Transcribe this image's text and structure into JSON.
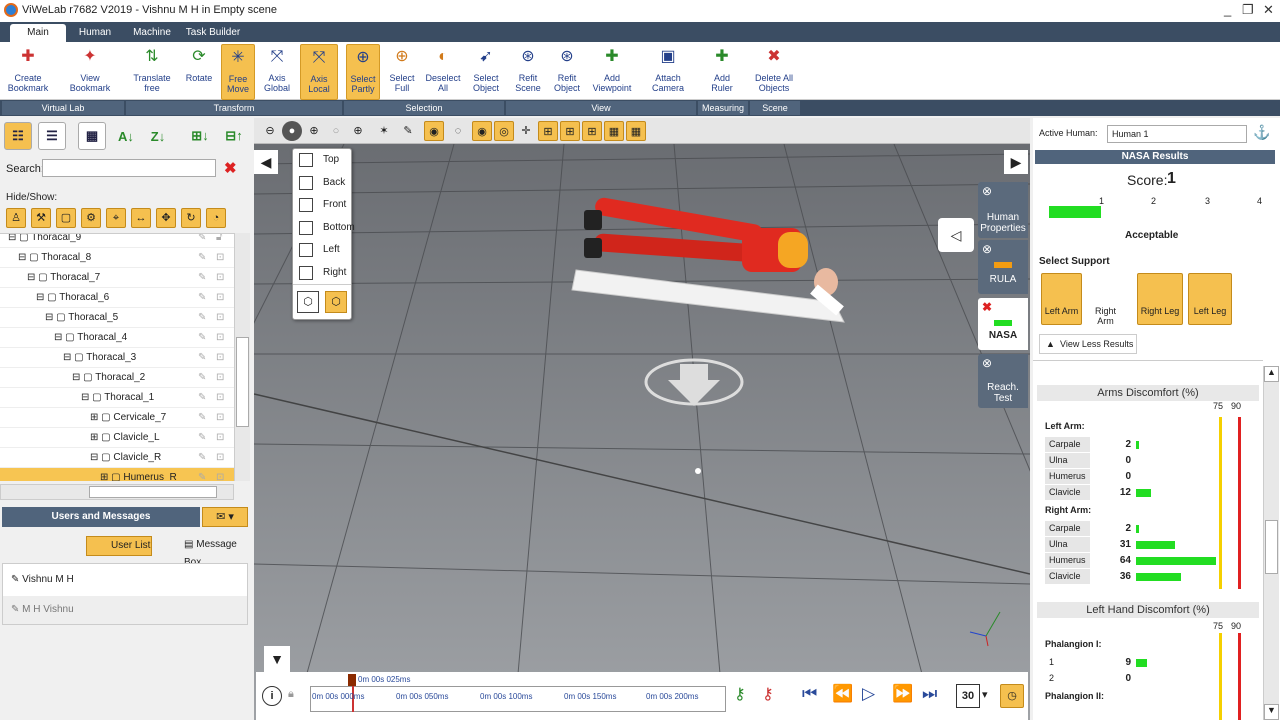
{
  "window": {
    "title": "ViWeLab r7682 V2019 - Vishnu  M H in Empty scene"
  },
  "ribbon": {
    "tabs": [
      "Main",
      "Human",
      "Machine",
      "Task Builder"
    ],
    "buttons": [
      {
        "l1": "Create",
        "l2": "Bookmark"
      },
      {
        "l1": "View",
        "l2": "Bookmark"
      },
      {
        "l1": "Translate",
        "l2": "free"
      },
      {
        "l1": "Rotate",
        "l2": ""
      },
      {
        "l1": "Free",
        "l2": "Move"
      },
      {
        "l1": "Axis",
        "l2": "Global"
      },
      {
        "l1": "Axis",
        "l2": "Local"
      },
      {
        "l1": "Select",
        "l2": "Partly"
      },
      {
        "l1": "Select",
        "l2": "Full"
      },
      {
        "l1": "Deselect",
        "l2": "All"
      },
      {
        "l1": "Select",
        "l2": "Object"
      },
      {
        "l1": "Refit",
        "l2": "Scene"
      },
      {
        "l1": "Refit",
        "l2": "Object"
      },
      {
        "l1": "Add",
        "l2": "Viewpoint"
      },
      {
        "l1": "Attach",
        "l2": "Camera"
      },
      {
        "l1": "Add",
        "l2": "Ruler"
      },
      {
        "l1": "Delete All",
        "l2": "Objects"
      }
    ],
    "groups": [
      "Virtual Lab",
      "Transform",
      "Selection",
      "View",
      "Measuring",
      "Scene"
    ]
  },
  "left": {
    "search_label": "Search:",
    "hideshow_label": "Hide/Show:",
    "tree": [
      "Thoracal_9",
      "Thoracal_8",
      "Thoracal_7",
      "Thoracal_6",
      "Thoracal_5",
      "Thoracal_4",
      "Thoracal_3",
      "Thoracal_2",
      "Thoracal_1",
      "Cervicale_7",
      "Clavicle_L",
      "Clavicle_R",
      "Humerus_R"
    ],
    "users_title": "Users and Messages",
    "user_list_btn": "User List",
    "message_box_btn": "Message Box",
    "users": [
      "Vishnu  M H",
      "M H Vishnu"
    ]
  },
  "viewport": {
    "view_menu": [
      "Top",
      "Back",
      "Front",
      "Bottom",
      "Left",
      "Right"
    ],
    "side_tabs": [
      {
        "l1": "Human",
        "l2": "Properties"
      },
      {
        "l1": "RULA",
        "l2": ""
      },
      {
        "l1": "NASA",
        "l2": ""
      },
      {
        "l1": "Reach.",
        "l2": "Test"
      }
    ]
  },
  "right": {
    "active_human_label": "Active Human:",
    "active_human_value": "Human 1",
    "nasa_title": "NASA Results",
    "score_label": "Score:",
    "score_value": "1",
    "scale": [
      "1",
      "2",
      "3",
      "4"
    ],
    "score_fraction": 0.25,
    "status": "Acceptable",
    "support_label": "Select Support",
    "supports": [
      {
        "label": "Left Arm",
        "on": true
      },
      {
        "label": "Right Arm",
        "on": false
      },
      {
        "label": "Right Leg",
        "on": true
      },
      {
        "label": "Left Leg",
        "on": true
      }
    ],
    "view_less": "View Less Results",
    "arms_title": "Arms Discomfort (%)",
    "thresholds": [
      "75",
      "90"
    ],
    "left_arm_label": "Left Arm:",
    "left_arm": [
      {
        "name": "Carpale",
        "value": 2
      },
      {
        "name": "Ulna",
        "value": 0
      },
      {
        "name": "Humerus",
        "value": 0
      },
      {
        "name": "Clavicle",
        "value": 12
      }
    ],
    "right_arm_label": "Right Arm:",
    "right_arm": [
      {
        "name": "Carpale",
        "value": 2
      },
      {
        "name": "Ulna",
        "value": 31
      },
      {
        "name": "Humerus",
        "value": 64
      },
      {
        "name": "Clavicle",
        "value": 36
      }
    ],
    "hand_title": "Left Hand Discomfort (%)",
    "phal1_label": "Phalangion I:",
    "phal1": [
      {
        "name": "1",
        "value": 9
      },
      {
        "name": "2",
        "value": 0
      }
    ],
    "phal2_label": "Phalangion II:"
  },
  "timeline": {
    "current": "0m 00s 025ms",
    "ticks": [
      "0m 00s 000ms",
      "0m 00s 050ms",
      "0m 00s 100ms",
      "0m 00s 150ms",
      "0m 00s 200ms"
    ],
    "frame_count": "30"
  },
  "colors": {
    "accent": "#f5c04f",
    "header": "#3b4d63",
    "bar": "#22dd22"
  }
}
